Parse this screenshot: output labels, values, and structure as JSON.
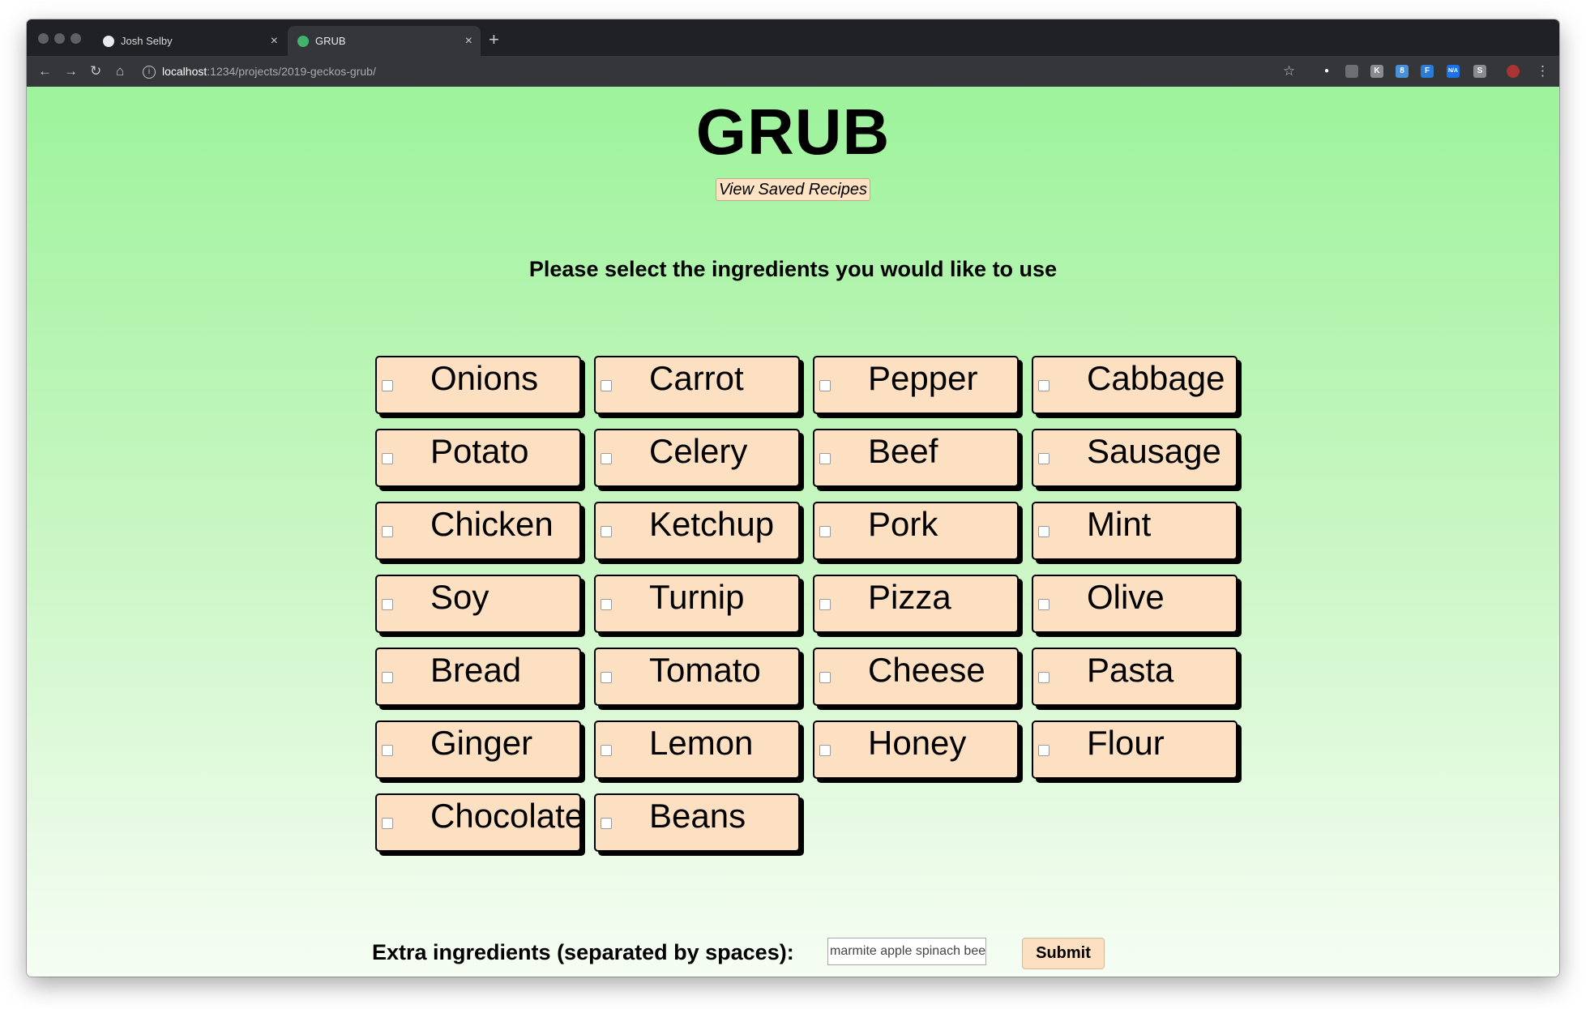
{
  "browser": {
    "tabs": [
      {
        "title": "Josh Selby",
        "active": false
      },
      {
        "title": "GRUB",
        "active": true
      }
    ],
    "new_tab": "+",
    "close_glyph": "×",
    "url_host": "localhost",
    "url_path": ":1234/projects/2019-geckos-grub/",
    "extension_icons": [
      "star-icon",
      "pin-icon",
      "screenshot-icon",
      "k-extension-icon",
      "8-extension-icon",
      "f-extension-icon",
      "na-extension-icon",
      "s-extension-icon",
      "profile-icon",
      "menu-icon"
    ]
  },
  "header": {
    "title": "GRUB",
    "saved_button": "View Saved Recipes"
  },
  "main": {
    "instructions": "Please select the ingredients you would like to use",
    "ingredients": [
      "Onions",
      "Carrot",
      "Pepper",
      "Cabbage",
      "Potato",
      "Celery",
      "Beef",
      "Sausage",
      "Chicken",
      "Ketchup",
      "Pork",
      "Mint",
      "Soy",
      "Turnip",
      "Pizza",
      "Olive",
      "Bread",
      "Tomato",
      "Cheese",
      "Pasta",
      "Ginger",
      "Lemon",
      "Honey",
      "Flour",
      "Chocolate",
      "Beans"
    ],
    "extra_label": "Extra ingredients (separated by spaces):",
    "extra_value": "marmite apple spinach bee",
    "submit_label": "Submit"
  },
  "colors": {
    "card_fill": "#fde0c2",
    "page_top": "#9df39b",
    "page_bottom": "#f6fdf4"
  }
}
